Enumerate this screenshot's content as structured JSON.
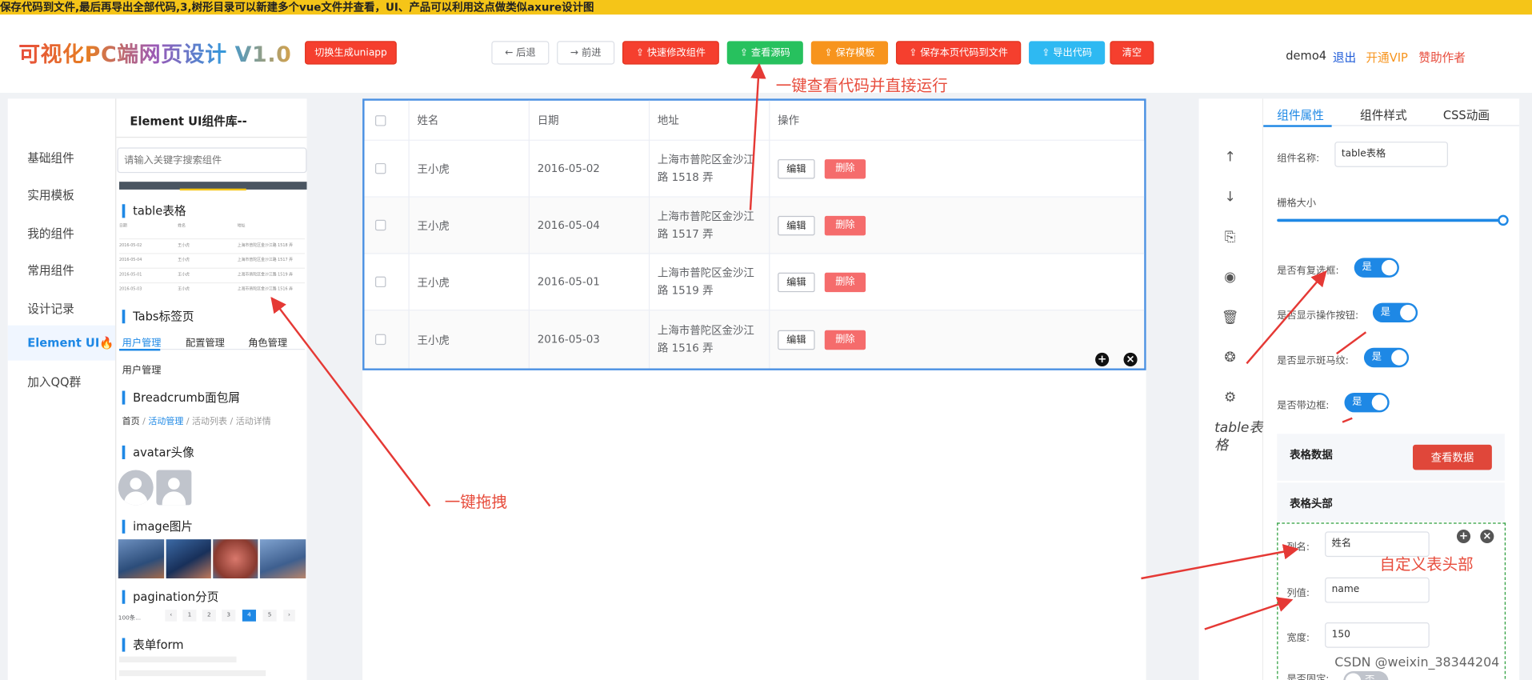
{
  "banner": {
    "text": "保存代码到文件,最后再导出全部代码,3,树形目录可以新建多个vue文件并查看，UI、产品可以利用这点做类似axure设计图"
  },
  "header": {
    "logo": "可视化PC端网页设计 V1.0",
    "uniapp_button": "切换生成uniapp",
    "back_button": "← 后退",
    "forward_button": "→ 前进",
    "quick_edit_button": "快速修改组件",
    "view_source_button": "查看源码",
    "save_template_button": "保存模板",
    "save_page_button": "保存本页代码到文件",
    "export_button": "导出代码",
    "clear_button": "清空",
    "user": "demo4",
    "logout": "退出",
    "vip": "开通VIP",
    "sponsor": "赞助作者"
  },
  "left_nav": {
    "items": [
      "基础组件",
      "实用模板",
      "我的组件",
      "常用组件",
      "设计记录",
      "Element UI",
      "加入QQ群"
    ]
  },
  "library": {
    "title": "Element UI组件库--",
    "search_placeholder": "请输入关键字搜索组件",
    "sections": {
      "table": "table表格",
      "tabs": "Tabs标签页",
      "breadcrumb": "Breadcrumb面包屑",
      "avatar": "avatar头像",
      "image": "image图片",
      "pagination": "pagination分页",
      "form": "表单form"
    },
    "mini_table": {
      "headers": [
        "日期",
        "姓名",
        "地址"
      ],
      "rows": [
        [
          "2016-05-02",
          "王小虎",
          "上海市普陀区金沙江路 1518 弄"
        ],
        [
          "2016-05-04",
          "王小虎",
          "上海市普陀区金沙江路 1517 弄"
        ],
        [
          "2016-05-01",
          "王小虎",
          "上海市普陀区金沙江路 1519 弄"
        ],
        [
          "2016-05-03",
          "王小虎",
          "上海市普陀区金沙江路 1516 弄"
        ]
      ]
    },
    "tabs": [
      "用户管理",
      "配置管理",
      "角色管理"
    ],
    "tab_content": "用户管理",
    "breadcrumb": [
      "首页",
      "活动管理",
      "活动列表",
      "活动详情"
    ],
    "pagination": {
      "size": "100条...",
      "pages": [
        "1",
        "2",
        "3",
        "4",
        "5"
      ],
      "current": "4"
    }
  },
  "table": {
    "headers": [
      "姓名",
      "日期",
      "地址",
      "操作"
    ],
    "rows": [
      {
        "name": "王小虎",
        "date": "2016-05-02",
        "addr1": "上海市普陀区金沙江",
        "addr2": "路 1518 弄"
      },
      {
        "name": "王小虎",
        "date": "2016-05-04",
        "addr1": "上海市普陀区金沙江",
        "addr2": "路 1517 弄"
      },
      {
        "name": "王小虎",
        "date": "2016-05-01",
        "addr1": "上海市普陀区金沙江",
        "addr2": "路 1519 弄"
      },
      {
        "name": "王小虎",
        "date": "2016-05-03",
        "addr1": "上海市普陀区金沙江",
        "addr2": "路 1516 弄"
      }
    ],
    "edit_label": "编辑",
    "delete_label": "删除"
  },
  "toolbar": {
    "component_label": "table表格"
  },
  "props": {
    "tabs": [
      "组件属性",
      "组件样式",
      "CSS动画"
    ],
    "name_label": "组件名称:",
    "name_value": "table表格",
    "grid_label": "栅格大小",
    "grid_level": 1.0,
    "switch_on": "是",
    "switches": [
      "是否有复选框:",
      "是否显示操作按钮:",
      "是否显示斑马纹:",
      "是否带边框:"
    ],
    "table_data_label": "表格数据",
    "view_data_button": "查看数据",
    "table_header_label": "表格头部",
    "col_name_label": "列名:",
    "col_name_value": "姓名",
    "col_value_label": "列值:",
    "col_value_value": "name",
    "width_label": "宽度:",
    "width_value": "150",
    "fixed_label": "是否固定:",
    "switch_off": "否"
  },
  "annotations": {
    "run_code": "一键查看代码并直接运行",
    "drag": "一键拖拽",
    "custom_header": "自定义表头部"
  },
  "watermark": "CSDN @weixin_38344204",
  "colors": {
    "accent": "#1e88e5",
    "danger": "#f56c6c",
    "banner": "#f5c518"
  }
}
